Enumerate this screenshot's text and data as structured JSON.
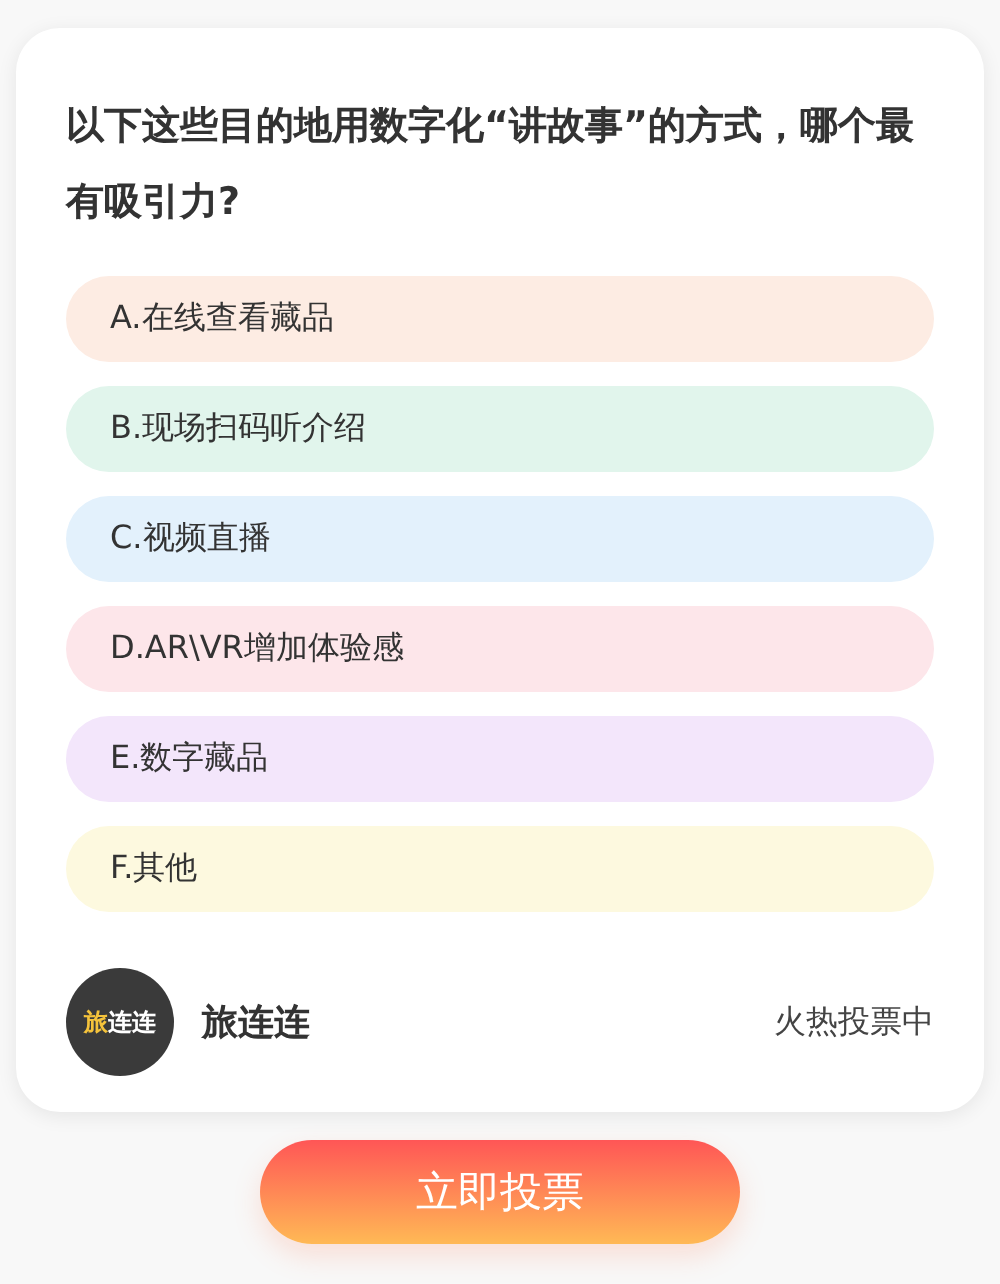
{
  "question": "以下这些目的地用数字化“讲故事”的方式，哪个最有吸引力?",
  "options": [
    {
      "label": "A.在线查看藏品",
      "color": "#fdece3"
    },
    {
      "label": "B.现场扫码听介绍",
      "color": "#e1f5ec"
    },
    {
      "label": "C.视频直播",
      "color": "#e3f1fc"
    },
    {
      "label": "D.AR\\VR增加体验感",
      "color": "#fde6ea"
    },
    {
      "label": "E.数字藏品",
      "color": "#f3e6fb"
    },
    {
      "label": "F.其他",
      "color": "#fdf9df"
    }
  ],
  "author": {
    "logo_accent": "旅",
    "logo_rest": "连连",
    "name": "旅连连"
  },
  "status": "火热投票中",
  "vote_button": "立即投票"
}
